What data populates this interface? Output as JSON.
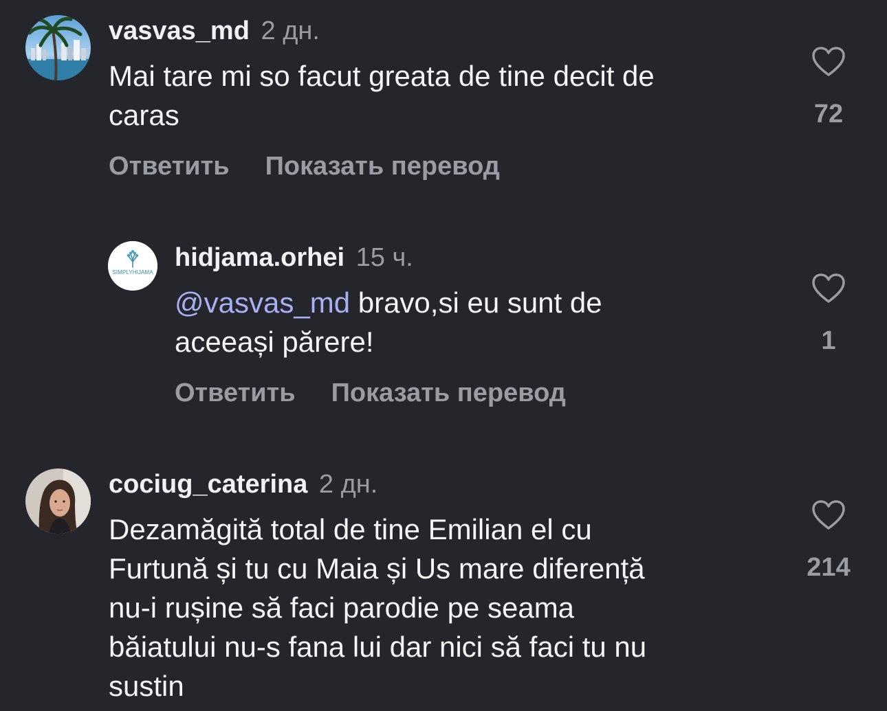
{
  "comments": [
    {
      "username": "vasvas_md",
      "time": "2 дн.",
      "mention": "",
      "text": "Mai tare mi so facut greata de tine decit de\ncaras",
      "likes": "72",
      "reply_label": "Ответить",
      "translate_label": "Показать перевод",
      "avatar_icon": "palm-beach-photo"
    },
    {
      "username": "hidjama.orhei",
      "time": "15 ч.",
      "mention": "@vasvas_md",
      "text": " bravo,si eu sunt de\naceeași părere!",
      "likes": "1",
      "reply_label": "Ответить",
      "translate_label": "Показать перевод",
      "avatar_icon": "simply-hijama-logo",
      "avatar_logo_text": "SIMPLYHIJAMA"
    },
    {
      "username": "cociug_caterina",
      "time": "2 дн.",
      "mention": "",
      "text": "Dezamăgită total de tine Emilian el cu\nFurtună  și tu cu Maia și Us mare diferență\nnu-i rușine să faci parodie pe seama\nbăiatului nu-s fana lui dar nici să faci tu nu\nsustin",
      "likes": "214",
      "avatar_icon": "portrait-photo"
    }
  ],
  "colors": {
    "background": "#25262b",
    "username": "#f2f2f4",
    "secondary_text": "#9a9ca3",
    "mention": "#a9aff5"
  }
}
